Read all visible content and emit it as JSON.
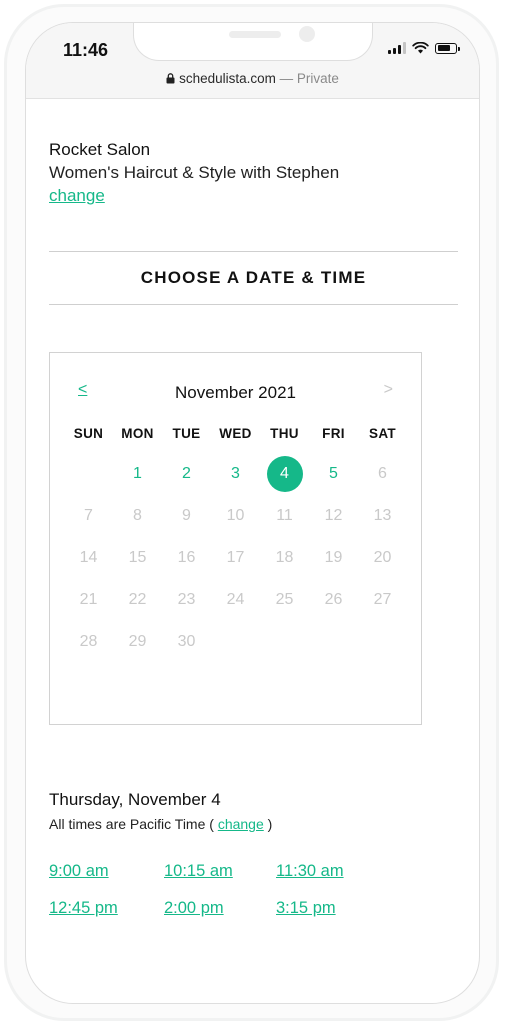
{
  "status_bar": {
    "time": "11:46"
  },
  "browser": {
    "domain": "schedulista.com",
    "separator": " — ",
    "privacy": "Private"
  },
  "booking": {
    "business": "Rocket Salon",
    "service": "Women's Haircut & Style with Stephen",
    "change_label": "change"
  },
  "section_title": "CHOOSE A DATE & TIME",
  "calendar": {
    "prev": "<",
    "next": ">",
    "month": "November 2021",
    "weekdays": [
      "SUN",
      "MON",
      "TUE",
      "WED",
      "THU",
      "FRI",
      "SAT"
    ],
    "first_weekday": 1,
    "days_in_month": 30,
    "available_days": [
      1,
      2,
      3,
      4,
      5
    ],
    "selected_day": 4
  },
  "selection": {
    "date_label": "Thursday, November 4",
    "tz_prefix": "All times are Pacific Time (",
    "tz_change": "change",
    "tz_suffix": ")"
  },
  "time_slots": [
    "9:00 am",
    "10:15 am",
    "11:30 am",
    "12:45 pm",
    "2:00 pm",
    "3:15 pm"
  ],
  "colors": {
    "accent": "#15b889",
    "disabled": "#c9c9c9"
  }
}
